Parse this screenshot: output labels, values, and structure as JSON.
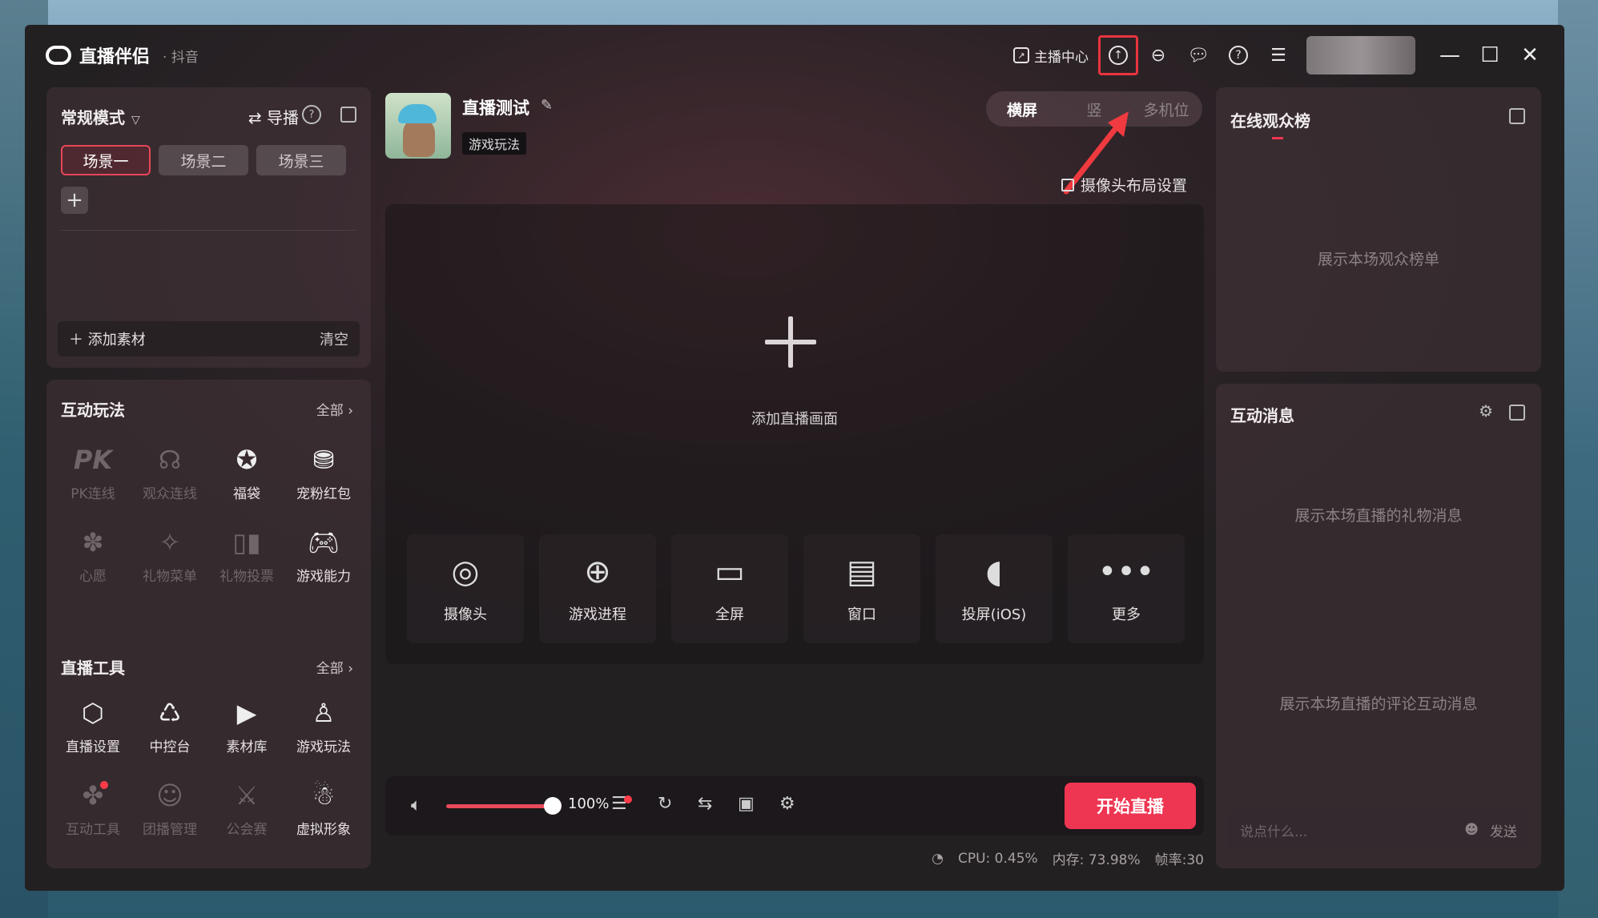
{
  "app": {
    "title": "直播伴侣",
    "platform": "· 抖音"
  },
  "titlebar": {
    "anchor_center": "主播中心",
    "icons": [
      "upload-icon",
      "controller-icon",
      "chat-bubble-icon",
      "help-icon",
      "menu-icon"
    ]
  },
  "left": {
    "mode_label": "常规模式",
    "director_label": "导播",
    "scenes": [
      "场景一",
      "场景二",
      "场景三"
    ],
    "add_material": "添加素材",
    "clear": "清空",
    "interactive": {
      "title": "互动玩法",
      "all": "全部",
      "items": [
        {
          "label": "PK连线",
          "enabled": false
        },
        {
          "label": "观众连线",
          "enabled": false
        },
        {
          "label": "福袋",
          "enabled": true
        },
        {
          "label": "宠粉红包",
          "enabled": true
        },
        {
          "label": "心愿",
          "enabled": false
        },
        {
          "label": "礼物菜单",
          "enabled": false
        },
        {
          "label": "礼物投票",
          "enabled": false
        },
        {
          "label": "游戏能力",
          "enabled": true
        }
      ]
    },
    "tools": {
      "title": "直播工具",
      "all": "全部",
      "items": [
        {
          "label": "直播设置",
          "enabled": true
        },
        {
          "label": "中控台",
          "enabled": true
        },
        {
          "label": "素材库",
          "enabled": true
        },
        {
          "label": "游戏玩法",
          "enabled": true
        },
        {
          "label": "互动工具",
          "enabled": false
        },
        {
          "label": "团播管理",
          "enabled": false
        },
        {
          "label": "公会赛",
          "enabled": false
        },
        {
          "label": "虚拟形象",
          "enabled": true
        }
      ]
    }
  },
  "center": {
    "room_title": "直播测试",
    "room_tag": "游戏玩法",
    "orientation": [
      "横屏",
      "竖",
      "多机位"
    ],
    "camera_layout": "摄像头布局设置",
    "add_scene_text": "添加直播画面",
    "sources": [
      "摄像头",
      "游戏进程",
      "全屏",
      "窗口",
      "投屏(iOS)",
      "更多"
    ],
    "volume_value": "100%",
    "volume_level": 1.0,
    "start_button": "开始直播",
    "status": {
      "cpu": "CPU: 0.45%",
      "mem": "内存: 73.98%",
      "fps": "帧率:30"
    }
  },
  "right": {
    "audience_title": "在线观众榜",
    "audience_placeholder": "展示本场观众榜单",
    "messages_title": "互动消息",
    "gift_placeholder": "展示本场直播的礼物消息",
    "comment_placeholder": "展示本场直播的评论互动消息",
    "input_placeholder": "说点什么...",
    "send_label": "发送"
  },
  "colors": {
    "accent": "#ee3552",
    "highlight": "#e8343f"
  }
}
